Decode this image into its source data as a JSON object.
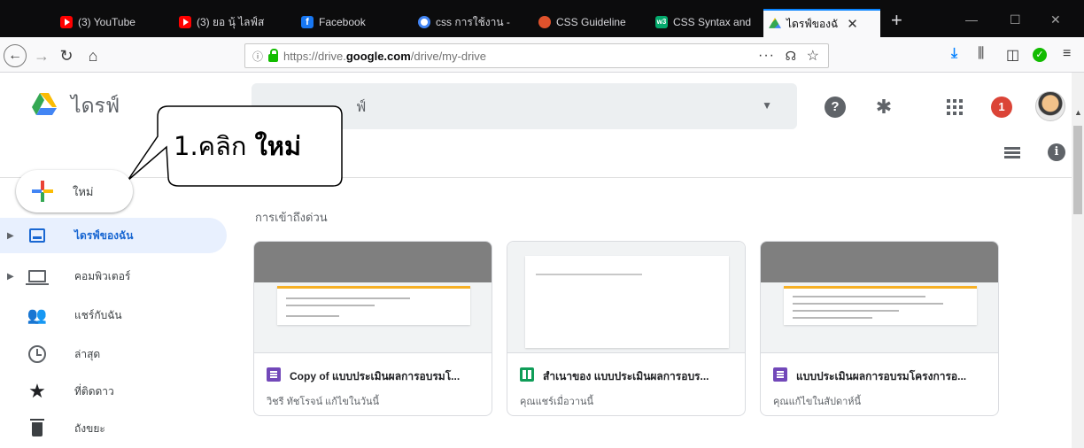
{
  "browser": {
    "tabs": [
      {
        "label": "(3) YouTube",
        "favicon": "youtube-icon"
      },
      {
        "label": "(3) ยอ นุ้ ไลฟ์ส",
        "favicon": "youtube-icon"
      },
      {
        "label": "Facebook",
        "favicon": "facebook-icon"
      },
      {
        "label": "css การใช้งาน -",
        "favicon": "google-icon"
      },
      {
        "label": "CSS Guideline",
        "favicon": "css-icon"
      },
      {
        "label": "CSS Syntax and",
        "favicon": "w3schools-icon"
      },
      {
        "label": "ไดรฟ์ของฉั",
        "favicon": "google-drive-icon",
        "active": true
      }
    ],
    "new_tab": "+",
    "window_controls": {
      "minimize": "—",
      "maximize": "☐",
      "close": "✕"
    },
    "url": {
      "prefix": "https://drive.",
      "domain": "google.com",
      "path": "/drive/my-drive"
    },
    "url_actions": {
      "more": "···",
      "pocket": "☊",
      "bookmark": "☆"
    }
  },
  "drive": {
    "app_name": "ไดรฟ์",
    "search_placeholder": "ฟ์",
    "callout": {
      "prefix": "1.คลิก ",
      "emphasis": "ใหม่"
    },
    "new_button": "ใหม่",
    "nav": [
      {
        "label": "ไดรฟ์ของฉัน",
        "icon": "my-drive-icon",
        "selected": true,
        "expandable": true
      },
      {
        "label": "คอมพิวเตอร์",
        "icon": "computer-icon",
        "expandable": true
      },
      {
        "label": "แชร์กับฉัน",
        "icon": "shared-icon"
      },
      {
        "label": "ล่าสุด",
        "icon": "recent-icon"
      },
      {
        "label": "ที่ติดดาว",
        "icon": "star-icon"
      },
      {
        "label": "ถังขยะ",
        "icon": "trash-icon"
      }
    ],
    "quick_access_title": "การเข้าถึงด่วน",
    "cards": [
      {
        "name": "Copy of แบบประเมินผลการอบรมโ...",
        "subtitle": "วิชรี ทัชโรจน์ แก้ไขในวันนี้",
        "type": "forms"
      },
      {
        "name": "สำเนาของ แบบประเมินผลการอบร...",
        "subtitle": "คุณแชร์เมื่อวานนี้",
        "type": "sheets"
      },
      {
        "name": "แบบประเมินผลการอบรมโครงการอ...",
        "subtitle": "คุณแก้ไขในสัปดาห์นี้",
        "type": "forms"
      }
    ],
    "header_icons": {
      "help": "?",
      "notifications": "1",
      "info": "i"
    },
    "colors": {
      "accent": "#1967d2",
      "selected_bg": "#e8f0fe",
      "notification": "#db4437"
    }
  }
}
